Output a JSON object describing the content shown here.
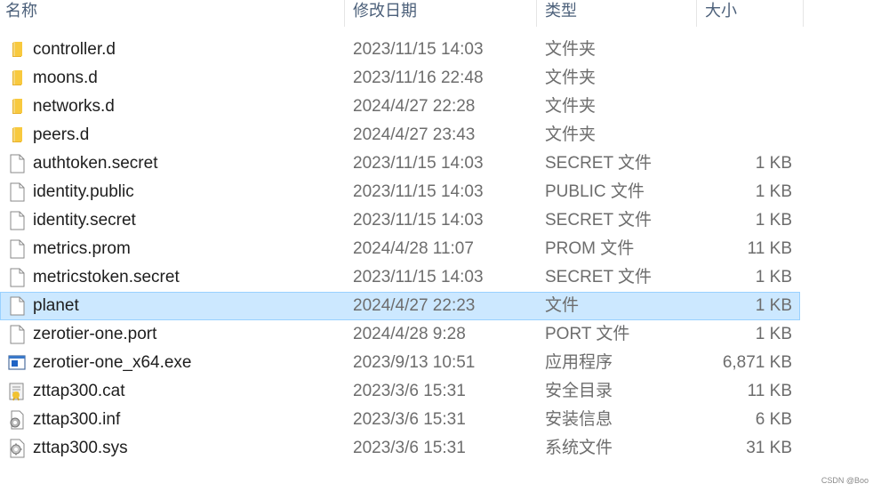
{
  "columns": {
    "name": "名称",
    "modified": "修改日期",
    "type": "类型",
    "size": "大小"
  },
  "files": [
    {
      "name": "controller.d",
      "modified": "2023/11/15 14:03",
      "type": "文件夹",
      "size": "",
      "icon": "folder-icon"
    },
    {
      "name": "moons.d",
      "modified": "2023/11/16 22:48",
      "type": "文件夹",
      "size": "",
      "icon": "folder-icon"
    },
    {
      "name": "networks.d",
      "modified": "2024/4/27 22:28",
      "type": "文件夹",
      "size": "",
      "icon": "folder-icon"
    },
    {
      "name": "peers.d",
      "modified": "2024/4/27 23:43",
      "type": "文件夹",
      "size": "",
      "icon": "folder-icon"
    },
    {
      "name": "authtoken.secret",
      "modified": "2023/11/15 14:03",
      "type": "SECRET 文件",
      "size": "1 KB",
      "icon": "file-icon"
    },
    {
      "name": "identity.public",
      "modified": "2023/11/15 14:03",
      "type": "PUBLIC 文件",
      "size": "1 KB",
      "icon": "file-icon"
    },
    {
      "name": "identity.secret",
      "modified": "2023/11/15 14:03",
      "type": "SECRET 文件",
      "size": "1 KB",
      "icon": "file-icon"
    },
    {
      "name": "metrics.prom",
      "modified": "2024/4/28 11:07",
      "type": "PROM 文件",
      "size": "11 KB",
      "icon": "file-icon"
    },
    {
      "name": "metricstoken.secret",
      "modified": "2023/11/15 14:03",
      "type": "SECRET 文件",
      "size": "1 KB",
      "icon": "file-icon"
    },
    {
      "name": "planet",
      "modified": "2024/4/27 22:23",
      "type": "文件",
      "size": "1 KB",
      "icon": "file-icon",
      "selected": true
    },
    {
      "name": "zerotier-one.port",
      "modified": "2024/4/28 9:28",
      "type": "PORT 文件",
      "size": "1 KB",
      "icon": "file-icon"
    },
    {
      "name": "zerotier-one_x64.exe",
      "modified": "2023/9/13 10:51",
      "type": "应用程序",
      "size": "6,871 KB",
      "icon": "application-icon"
    },
    {
      "name": "zttap300.cat",
      "modified": "2023/3/6 15:31",
      "type": "安全目录",
      "size": "11 KB",
      "icon": "security-catalog-icon"
    },
    {
      "name": "zttap300.inf",
      "modified": "2023/3/6 15:31",
      "type": "安装信息",
      "size": "6 KB",
      "icon": "setup-info-icon"
    },
    {
      "name": "zttap300.sys",
      "modified": "2023/3/6 15:31",
      "type": "系统文件",
      "size": "31 KB",
      "icon": "system-file-icon"
    }
  ],
  "watermark": "CSDN @Boo",
  "colors": {
    "selection_bg": "#cce8ff",
    "selection_border": "#99d1ff",
    "header_text": "#4c607a",
    "folder": "#f8c93e"
  }
}
